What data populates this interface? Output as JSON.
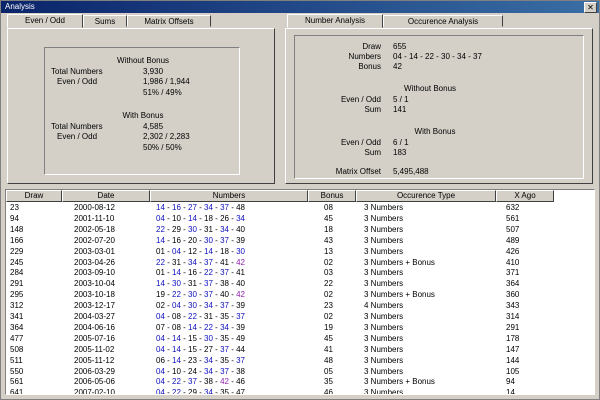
{
  "window": {
    "title": "Analysis",
    "close_glyph": "✕"
  },
  "left_tabs": [
    "Even / Odd",
    "Sums",
    "Matrix Offsets"
  ],
  "even_odd": {
    "without_heading": "Without Bonus",
    "without_total_label": "Total Numbers",
    "without_total_value": "3,930",
    "without_eo_label": "Even / Odd",
    "without_eo_value": "1,986 / 1,944",
    "without_pct": "51% / 49%",
    "with_heading": "With Bonus",
    "with_total_label": "Total Numbers",
    "with_total_value": "4,585",
    "with_eo_label": "Even / Odd",
    "with_eo_value": "2,302 / 2,283",
    "with_pct": "50% / 50%"
  },
  "right_tabs": [
    "Number Analysis",
    "Occurence Analysis"
  ],
  "number_analysis": {
    "draw_label": "Draw",
    "draw_value": "655",
    "numbers_label": "Numbers",
    "numbers_value": "04 - 14 - 22 - 30 - 34 - 37",
    "bonus_label": "Bonus",
    "bonus_value": "42",
    "without_heading": "Without Bonus",
    "without_eo_label": "Even / Odd",
    "without_eo_value": "5 / 1",
    "without_sum_label": "Sum",
    "without_sum_value": "141",
    "with_heading": "With Bonus",
    "with_eo_label": "Even / Odd",
    "with_eo_value": "6 / 1",
    "with_sum_label": "Sum",
    "with_sum_value": "183",
    "matrix_label": "Matrix Offset",
    "matrix_value": "5,495,488"
  },
  "table": {
    "columns": [
      "Draw",
      "Date",
      "Numbers",
      "Bonus",
      "Occurence Type",
      "X Ago"
    ],
    "rows": [
      {
        "draw": "23",
        "date": "2000-08-12",
        "numbers": [
          [
            "14",
            "bl"
          ],
          [
            "16",
            "bl"
          ],
          [
            "27",
            "bl"
          ],
          [
            "34",
            "bl"
          ],
          [
            "37",
            "bl"
          ],
          [
            "48",
            ""
          ]
        ],
        "bonus": "08",
        "type": "3 Numbers",
        "ago": "632"
      },
      {
        "draw": "94",
        "date": "2001-11-10",
        "numbers": [
          [
            "04",
            "bl"
          ],
          [
            "10",
            ""
          ],
          [
            "14",
            "bl"
          ],
          [
            "18",
            ""
          ],
          [
            "26",
            ""
          ],
          [
            "34",
            "bl"
          ]
        ],
        "bonus": "45",
        "type": "3 Numbers",
        "ago": "561"
      },
      {
        "draw": "148",
        "date": "2002-05-18",
        "numbers": [
          [
            "22",
            "bl"
          ],
          [
            "29",
            ""
          ],
          [
            "30",
            "bl"
          ],
          [
            "31",
            ""
          ],
          [
            "34",
            "bl"
          ],
          [
            "40",
            ""
          ]
        ],
        "bonus": "18",
        "type": "3 Numbers",
        "ago": "507"
      },
      {
        "draw": "166",
        "date": "2002-07-20",
        "numbers": [
          [
            "14",
            "bl"
          ],
          [
            "16",
            ""
          ],
          [
            "20",
            ""
          ],
          [
            "30",
            "bl"
          ],
          [
            "37",
            "bl"
          ],
          [
            "39",
            ""
          ]
        ],
        "bonus": "43",
        "type": "3 Numbers",
        "ago": "489"
      },
      {
        "draw": "229",
        "date": "2003-03-01",
        "numbers": [
          [
            "01",
            ""
          ],
          [
            "04",
            "bl"
          ],
          [
            "12",
            ""
          ],
          [
            "14",
            "bl"
          ],
          [
            "18",
            ""
          ],
          [
            "30",
            "bl"
          ]
        ],
        "bonus": "13",
        "type": "3 Numbers",
        "ago": "426"
      },
      {
        "draw": "245",
        "date": "2003-04-26",
        "numbers": [
          [
            "22",
            "bl"
          ],
          [
            "31",
            ""
          ],
          [
            "34",
            "bl"
          ],
          [
            "37",
            "bl"
          ],
          [
            "41",
            ""
          ],
          [
            "42",
            "pu"
          ]
        ],
        "bonus": "02",
        "type": "3 Numbers + Bonus",
        "ago": "410"
      },
      {
        "draw": "284",
        "date": "2003-09-10",
        "numbers": [
          [
            "01",
            ""
          ],
          [
            "14",
            "bl"
          ],
          [
            "16",
            ""
          ],
          [
            "22",
            "bl"
          ],
          [
            "37",
            "bl"
          ],
          [
            "41",
            ""
          ]
        ],
        "bonus": "03",
        "type": "3 Numbers",
        "ago": "371"
      },
      {
        "draw": "291",
        "date": "2003-10-04",
        "numbers": [
          [
            "14",
            "bl"
          ],
          [
            "30",
            "bl"
          ],
          [
            "31",
            ""
          ],
          [
            "37",
            "bl"
          ],
          [
            "38",
            ""
          ],
          [
            "40",
            ""
          ]
        ],
        "bonus": "22",
        "type": "3 Numbers",
        "ago": "364"
      },
      {
        "draw": "295",
        "date": "2003-10-18",
        "numbers": [
          [
            "19",
            ""
          ],
          [
            "22",
            "bl"
          ],
          [
            "30",
            "bl"
          ],
          [
            "37",
            "bl"
          ],
          [
            "40",
            ""
          ],
          [
            "42",
            "pu"
          ]
        ],
        "bonus": "02",
        "type": "3 Numbers + Bonus",
        "ago": "360"
      },
      {
        "draw": "312",
        "date": "2003-12-17",
        "numbers": [
          [
            "02",
            ""
          ],
          [
            "04",
            "bl"
          ],
          [
            "30",
            "bl"
          ],
          [
            "34",
            "bl"
          ],
          [
            "37",
            "bl"
          ],
          [
            "39",
            ""
          ]
        ],
        "bonus": "23",
        "type": "4 Numbers",
        "ago": "343"
      },
      {
        "draw": "341",
        "date": "2004-03-27",
        "numbers": [
          [
            "04",
            "bl"
          ],
          [
            "08",
            ""
          ],
          [
            "22",
            "bl"
          ],
          [
            "31",
            ""
          ],
          [
            "35",
            ""
          ],
          [
            "37",
            "bl"
          ]
        ],
        "bonus": "02",
        "type": "3 Numbers",
        "ago": "314"
      },
      {
        "draw": "364",
        "date": "2004-06-16",
        "numbers": [
          [
            "07",
            ""
          ],
          [
            "08",
            ""
          ],
          [
            "14",
            "bl"
          ],
          [
            "22",
            "bl"
          ],
          [
            "34",
            "bl"
          ],
          [
            "39",
            ""
          ]
        ],
        "bonus": "19",
        "type": "3 Numbers",
        "ago": "291"
      },
      {
        "draw": "477",
        "date": "2005-07-16",
        "numbers": [
          [
            "04",
            "bl"
          ],
          [
            "14",
            "bl"
          ],
          [
            "15",
            ""
          ],
          [
            "30",
            "bl"
          ],
          [
            "35",
            ""
          ],
          [
            "49",
            ""
          ]
        ],
        "bonus": "45",
        "type": "3 Numbers",
        "ago": "178"
      },
      {
        "draw": "508",
        "date": "2005-11-02",
        "numbers": [
          [
            "04",
            "bl"
          ],
          [
            "14",
            "bl"
          ],
          [
            "15",
            ""
          ],
          [
            "27",
            ""
          ],
          [
            "37",
            "bl"
          ],
          [
            "44",
            ""
          ]
        ],
        "bonus": "41",
        "type": "3 Numbers",
        "ago": "147"
      },
      {
        "draw": "511",
        "date": "2005-11-12",
        "numbers": [
          [
            "06",
            ""
          ],
          [
            "14",
            "bl"
          ],
          [
            "23",
            ""
          ],
          [
            "34",
            "bl"
          ],
          [
            "35",
            ""
          ],
          [
            "37",
            "bl"
          ]
        ],
        "bonus": "48",
        "type": "3 Numbers",
        "ago": "144"
      },
      {
        "draw": "550",
        "date": "2006-03-29",
        "numbers": [
          [
            "04",
            "bl"
          ],
          [
            "10",
            ""
          ],
          [
            "24",
            ""
          ],
          [
            "34",
            "bl"
          ],
          [
            "37",
            "bl"
          ],
          [
            "38",
            ""
          ]
        ],
        "bonus": "05",
        "type": "3 Numbers",
        "ago": "105"
      },
      {
        "draw": "561",
        "date": "2006-05-06",
        "numbers": [
          [
            "04",
            "bl"
          ],
          [
            "22",
            "bl"
          ],
          [
            "37",
            "bl"
          ],
          [
            "38",
            ""
          ],
          [
            "42",
            "pu"
          ],
          [
            "46",
            ""
          ]
        ],
        "bonus": "35",
        "type": "3 Numbers + Bonus",
        "ago": "94"
      },
      {
        "draw": "641",
        "date": "2007-02-10",
        "numbers": [
          [
            "04",
            "bl"
          ],
          [
            "22",
            "bl"
          ],
          [
            "29",
            ""
          ],
          [
            "34",
            "bl"
          ],
          [
            "35",
            ""
          ],
          [
            "47",
            ""
          ]
        ],
        "bonus": "46",
        "type": "3 Numbers",
        "ago": "14"
      }
    ]
  }
}
